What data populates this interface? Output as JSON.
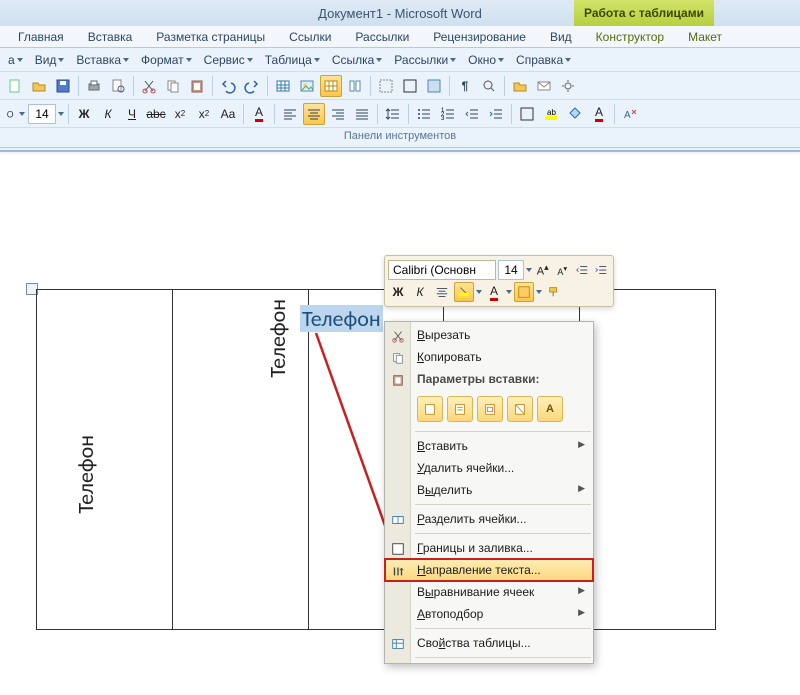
{
  "title": {
    "doc": "Документ1",
    "app": "Microsoft Word",
    "context_tools": "Работа с таблицами"
  },
  "tabs": {
    "home": "Главная",
    "insert": "Вставка",
    "layout_page": "Разметка страницы",
    "references": "Ссылки",
    "mailings": "Рассылки",
    "review": "Рецензирование",
    "view_tab": "Вид",
    "designer": "Конструктор",
    "layout": "Макет"
  },
  "menus": {
    "file_like": "а",
    "view": "Вид",
    "insert": "Вставка",
    "format": "Формат",
    "service": "Сервис",
    "table": "Таблица",
    "link": "Ссылка",
    "mailing": "Рассылки",
    "window": "Окно",
    "help": "Справка"
  },
  "toolbar": {
    "fontsize": "14",
    "panels_label": "Панели инструментов"
  },
  "mini": {
    "font": "Calibri (Основн",
    "size": "14"
  },
  "cell_text": {
    "vertical1": "Телефон",
    "vertical2": "Телефон",
    "selected": "Телефон"
  },
  "ctx": {
    "cut": "Вырезать",
    "copy": "Копировать",
    "paste_opts_header": "Параметры вставки:",
    "paste": "Вставить",
    "delete_cells": "Удалить ячейки...",
    "select": "Выделить",
    "split_cells": "Разделить ячейки...",
    "borders": "Границы и заливка...",
    "text_direction": "Направление текста...",
    "cell_align": "Выравнивание ячеек",
    "autofit": "Автоподбор",
    "table_props": "Свойства таблицы...",
    "paste_opt_a": "A"
  }
}
